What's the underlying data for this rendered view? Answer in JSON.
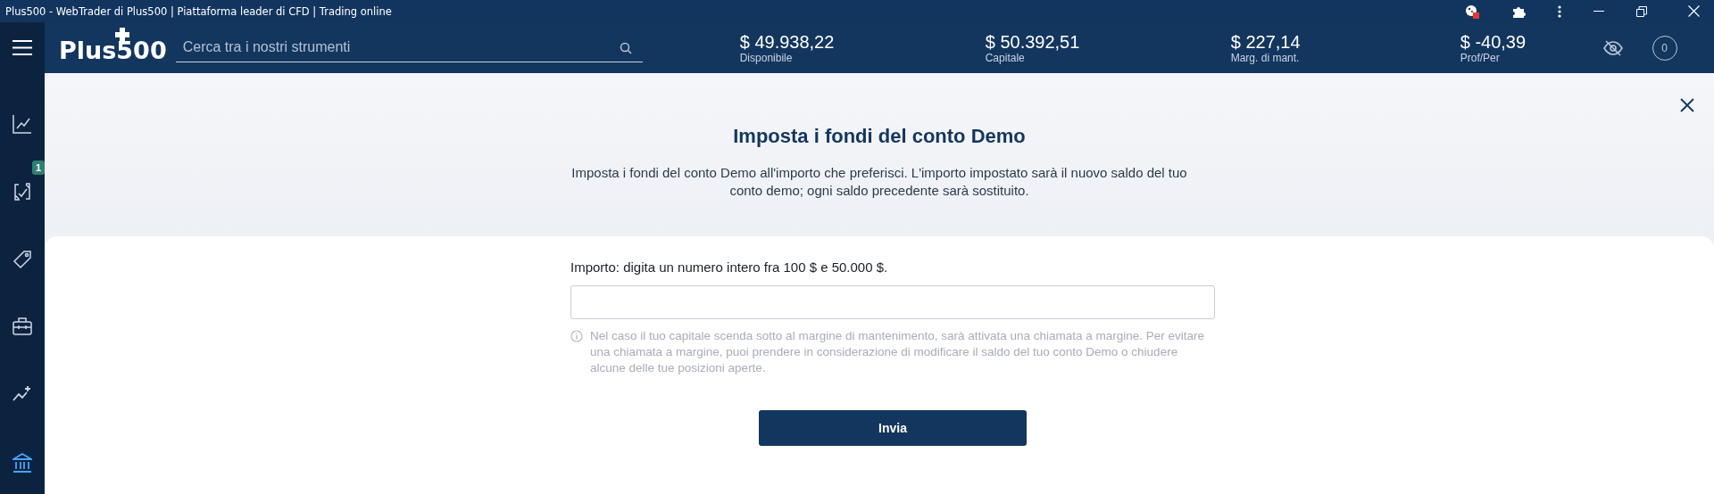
{
  "window": {
    "title": "Plus500 - WebTrader di Plus500 | Piattaforma leader di CFD | Trading online"
  },
  "header": {
    "logo": "Plus500",
    "search": {
      "placeholder": "Cerca tra i nostri strumenti"
    },
    "stats": [
      {
        "value": "$ 49.938,22",
        "label": "Disponibile"
      },
      {
        "value": "$ 50.392,51",
        "label": "Capitale"
      },
      {
        "value": "$ 227,14",
        "label": "Marg. di mant."
      },
      {
        "value": "$ -40,39",
        "label": "Prof/Per"
      }
    ],
    "notifications_count": "0"
  },
  "sidebar": {
    "items": [
      {
        "kind": "chart",
        "selected": false
      },
      {
        "kind": "trades",
        "selected": false,
        "badge": "1"
      },
      {
        "kind": "tag",
        "selected": false
      },
      {
        "kind": "briefcase",
        "selected": false
      },
      {
        "kind": "insights",
        "selected": false
      },
      {
        "kind": "bank",
        "selected": true
      }
    ]
  },
  "dialog": {
    "title": "Imposta i fondi del conto Demo",
    "description": "Imposta i fondi del conto Demo all'importo che preferisci. L'importo impostato sarà il nuovo saldo del tuo conto demo; ogni saldo precedente sarà sostituito.",
    "field_label": "Importo: digita un numero intero fra 100 $ e 50.000 $.",
    "note": "Nel caso il tuo capitale scenda sotto al margine di mantenimento, sarà attivata una chiamata a margine. Per evitare una chiamata a margine, puoi prendere in considerazione di modificare il saldo del tuo conto Demo o chiudere alcune delle tue posizioni aperte.",
    "submit": "Invia"
  }
}
